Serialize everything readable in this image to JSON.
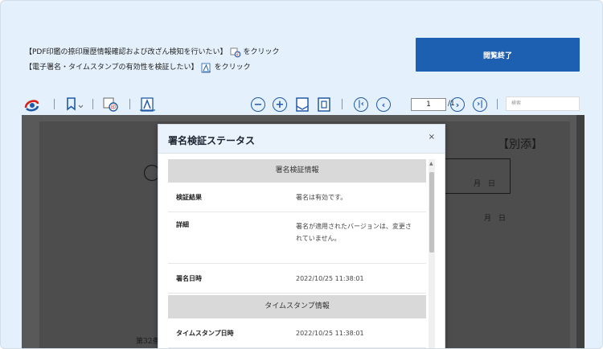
{
  "instructions": {
    "line1_text": "【PDF印鑑の捺印履歴情報確認および改ざん検知を行いたい】",
    "line1_suffix": "をクリック",
    "line2_text": "【電子署名・タイムスタンプの有効性を検証したい】",
    "line2_suffix": "をクリック"
  },
  "end_button_label": "閲覧終了",
  "toolbar": {
    "page_value": "1",
    "page_total": "/1",
    "search_placeholder": "検索"
  },
  "document": {
    "heading": "【別添】",
    "date_label_1": "月　日",
    "date_label_2": "月　日",
    "article": "第32条"
  },
  "dialog": {
    "title": "署名検証ステータス",
    "close": "×",
    "signature_section": "署名検証情報",
    "verification_result_label": "検証結果",
    "verification_result_value": "署名は有効です。",
    "details_label": "詳細",
    "details_value": "署名が適用されたバージョンは、変更されていません。",
    "signing_time_label": "署名日時",
    "signing_time_value": "2022/10/25 11:38:01",
    "timestamp_section": "タイムスタンプ情報",
    "timestamp_time_label": "タイムスタンプ日時",
    "timestamp_time_value": "2022/10/25 11:38:01"
  },
  "colors": {
    "background": "#e4f0fb",
    "accent": "#1d5fb0",
    "viewer": "#595959",
    "dialog_header": "#eaf3fc",
    "section_head": "#d9d9d9"
  }
}
